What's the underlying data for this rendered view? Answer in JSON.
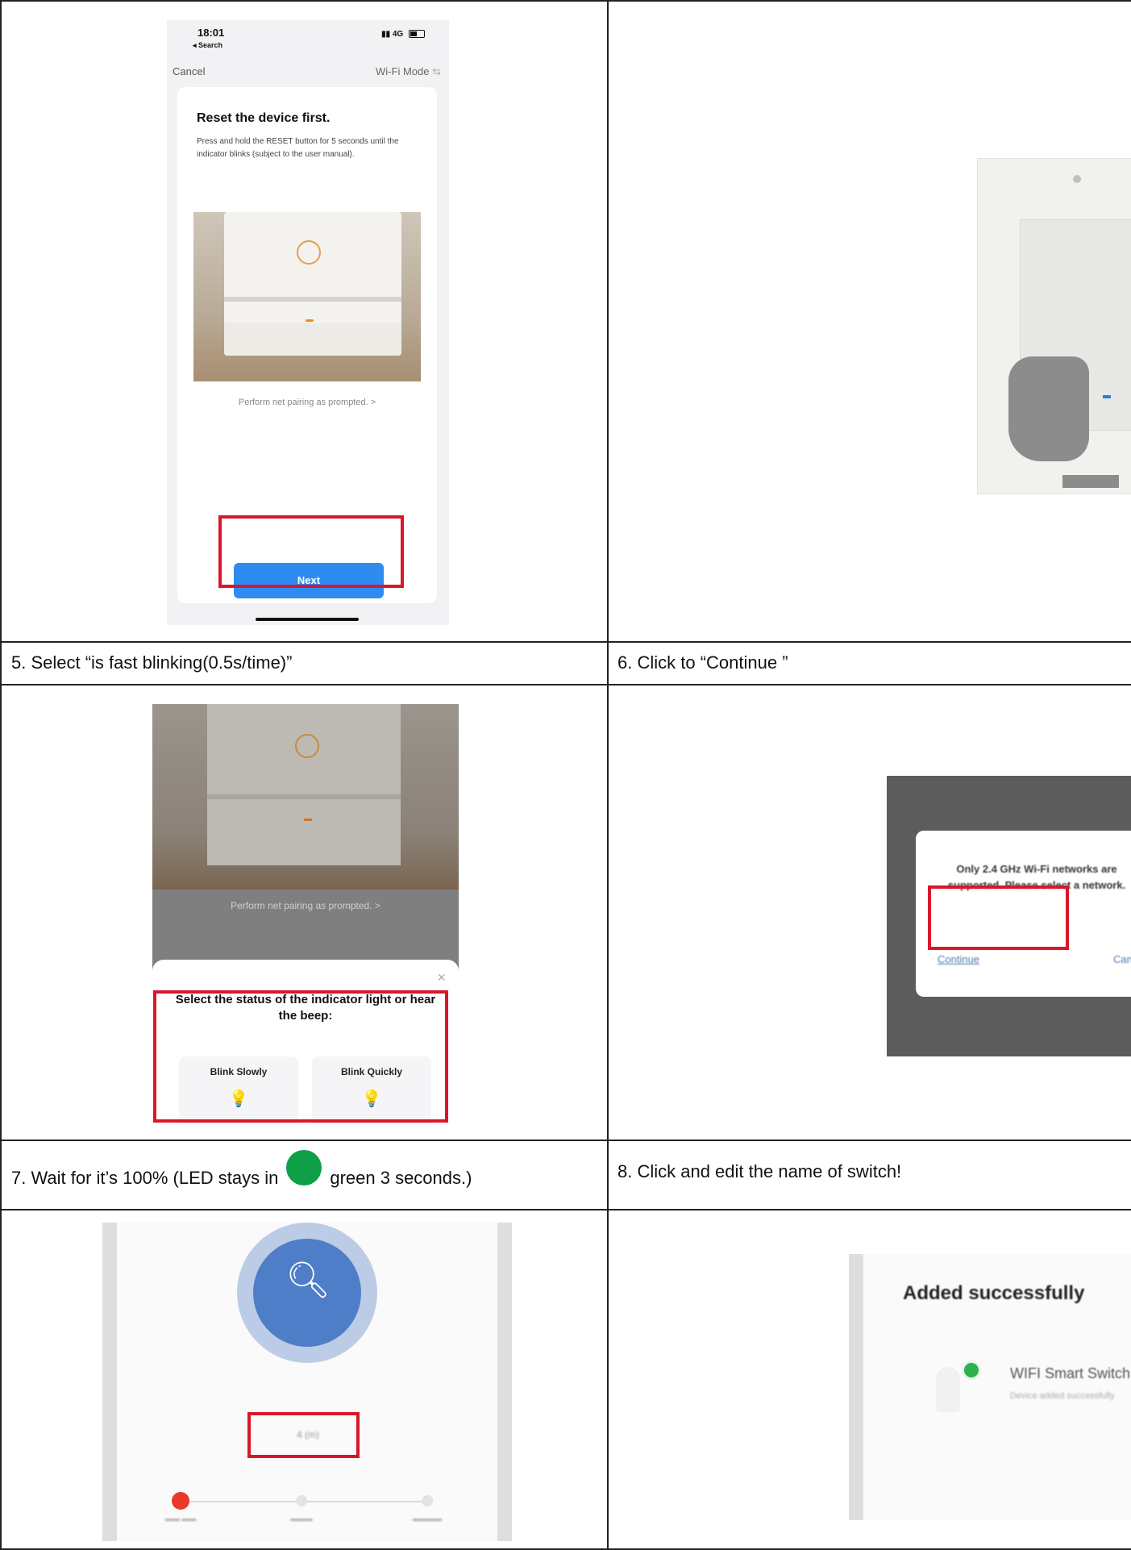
{
  "captions": {
    "step5": "5. Select “is fast blinking(0.5s/time)”",
    "step6": "6. Click to “Continue ”",
    "step7_before": "7. Wait for it’s 100% (LED stays in",
    "step7_after": "green 3 seconds.)",
    "step8": "8. Click and edit the name of switch!"
  },
  "screen_reset": {
    "status_time": "18:01",
    "status_back": "◂ Search",
    "status_network": "4G",
    "cancel_label": "Cancel",
    "mode_label": "Wi-Fi Mode",
    "title": "Reset the device first.",
    "description": "Press and hold the RESET button for 5 seconds until the indicator blinks (subject to the user manual).",
    "pairing_link": "Perform net pairing as prompted. >",
    "next_label": "Next"
  },
  "screen_blink": {
    "pairing_link": "Perform net pairing as prompted. >",
    "sheet_title": "Select the status of the indicator light or hear the beep:",
    "option_slow": "Blink Slowly",
    "option_fast": "Blink Quickly",
    "close_glyph": "×"
  },
  "screen_dialog": {
    "message": "Only 2.4 GHz Wi-Fi networks are supported. Please select a network.",
    "continue_label": "Continue",
    "cancel_label": "Cancel"
  },
  "screen_progress": {
    "percent_text": "4 (m)"
  },
  "screen_success": {
    "title": "Added successfully",
    "device_name": "WIFI Smart Switch",
    "device_sub": "Device added successfully"
  },
  "colors": {
    "highlight_red": "#d8172b",
    "next_blue": "#2e8cf0",
    "led_green": "#0fa047"
  }
}
